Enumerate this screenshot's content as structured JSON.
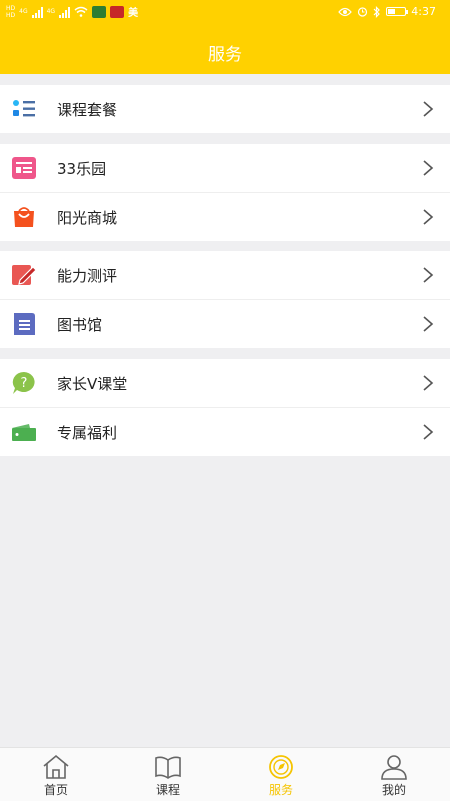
{
  "status_bar": {
    "time": "4:37",
    "carrier1": "HD",
    "carrier2": "HD",
    "net1": "4G",
    "net2": "4G",
    "app_badge": "美"
  },
  "header": {
    "title": "服务"
  },
  "groups": [
    {
      "items": [
        {
          "label": "课程套餐",
          "icon": "course-package-icon"
        }
      ]
    },
    {
      "items": [
        {
          "label": "33乐园",
          "icon": "park-icon"
        },
        {
          "label": "阳光商城",
          "icon": "shopping-bag-icon"
        }
      ]
    },
    {
      "items": [
        {
          "label": "能力测评",
          "icon": "pencil-edit-icon"
        },
        {
          "label": "图书馆",
          "icon": "document-icon"
        }
      ]
    },
    {
      "items": [
        {
          "label": "家长V课堂",
          "icon": "question-bubble-icon"
        },
        {
          "label": "专属福利",
          "icon": "ticket-icon"
        }
      ]
    }
  ],
  "tabs": [
    {
      "label": "首页",
      "icon": "home-icon",
      "active": false
    },
    {
      "label": "课程",
      "icon": "book-icon",
      "active": false
    },
    {
      "label": "服务",
      "icon": "compass-icon",
      "active": true
    },
    {
      "label": "我的",
      "icon": "user-icon",
      "active": false
    }
  ],
  "colors": {
    "header": "#ffd100",
    "active_tab": "#f5c400",
    "background": "#efeff1"
  }
}
